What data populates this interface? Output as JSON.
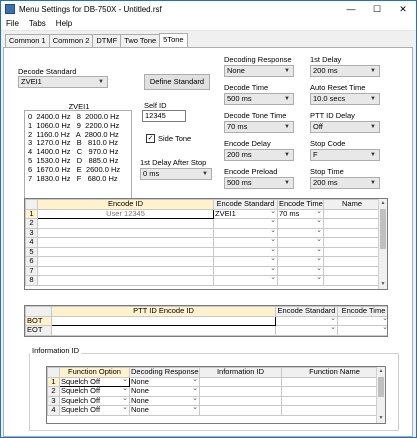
{
  "window": {
    "title": "Menu Settings for DB-750X - Untitled.rsf"
  },
  "titlebar_buttons": {
    "minimize": "—",
    "maximize": "☐",
    "close": "✕"
  },
  "menu": [
    "File",
    "Tabs",
    "Help"
  ],
  "tabs": [
    "Common 1",
    "Common 2",
    "DTMF",
    "Two Tone",
    "5Tone"
  ],
  "decode_standard": {
    "label": "Decode Standard",
    "value": "ZVEI1"
  },
  "define_standard_button": "Define Standard",
  "zvei_table": {
    "title": "ZVEI1",
    "rows": [
      "0  2400.0 Hz   8  2000.0 Hz",
      "1  1060.0 Hz   9  2200.0 Hz",
      "2  1160.0 Hz   A  2800.0 Hz",
      "3  1270.0 Hz   B   810.0 Hz",
      "4  1400.0 Hz   C   970.0 Hz",
      "5  1530.0 Hz   D   885.0 Hz",
      "6  1670.0 Hz   E  2600.0 Hz",
      "7  1830.0 Hz   F   680.0 Hz"
    ]
  },
  "self_id": {
    "label": "Self ID",
    "value": "12345"
  },
  "side_tone": {
    "label": "Side Tone",
    "checked": true,
    "mark": "✓"
  },
  "first_delay_after_stop": {
    "label": "1st Delay After Stop",
    "value": "0 ms"
  },
  "decoding_response": {
    "label": "Decoding Response",
    "value": "None"
  },
  "decode_time": {
    "label": "Decode Time",
    "value": "500 ms"
  },
  "decode_tone_time": {
    "label": "Decode Tone Time",
    "value": "70 ms"
  },
  "encode_delay": {
    "label": "Encode Delay",
    "value": "200 ms"
  },
  "encode_preload": {
    "label": "Encode Preload",
    "value": "500 ms"
  },
  "first_delay": {
    "label": "1st Delay",
    "value": "200 ms"
  },
  "auto_reset_time": {
    "label": "Auto Reset Time",
    "value": "10.0 secs"
  },
  "ptt_id_delay": {
    "label": "PTT ID Delay",
    "value": "Off"
  },
  "stop_code": {
    "label": "Stop Code",
    "value": "F"
  },
  "stop_time": {
    "label": "Stop Time",
    "value": "200 ms"
  },
  "encode_table": {
    "headers": [
      "Encode ID",
      "Encode Standard",
      "Encode Time",
      "Name"
    ],
    "rows": [
      {
        "num": "1",
        "id": "User 12345",
        "std": "ZVEI1",
        "time": "70 ms",
        "name": ""
      },
      {
        "num": "2",
        "id": "",
        "std": "",
        "time": "",
        "name": ""
      },
      {
        "num": "3",
        "id": "",
        "std": "",
        "time": "",
        "name": ""
      },
      {
        "num": "4",
        "id": "",
        "std": "",
        "time": "",
        "name": ""
      },
      {
        "num": "5",
        "id": "",
        "std": "",
        "time": "",
        "name": ""
      },
      {
        "num": "6",
        "id": "",
        "std": "",
        "time": "",
        "name": ""
      },
      {
        "num": "7",
        "id": "",
        "std": "",
        "time": "",
        "name": ""
      },
      {
        "num": "8",
        "id": "",
        "std": "",
        "time": "",
        "name": ""
      }
    ]
  },
  "ptt_table": {
    "headers": [
      "PTT ID Encode ID",
      "Encode Standard",
      "Encode Time"
    ],
    "rows": [
      {
        "num": "BOT",
        "id": "",
        "std": "",
        "time": ""
      },
      {
        "num": "EOT",
        "id": "",
        "std": "",
        "time": ""
      }
    ]
  },
  "information_id": {
    "title": "Information ID",
    "headers": [
      "Function Option",
      "Decoding Response",
      "Information ID",
      "Function Name"
    ],
    "rows": [
      {
        "num": "1",
        "opt": "Squelch Off",
        "resp": "None",
        "info": "",
        "name": ""
      },
      {
        "num": "2",
        "opt": "Squelch Off",
        "resp": "None",
        "info": "",
        "name": ""
      },
      {
        "num": "3",
        "opt": "Squelch Off",
        "resp": "None",
        "info": "",
        "name": ""
      },
      {
        "num": "4",
        "opt": "Squelch Off",
        "resp": "None",
        "info": "",
        "name": ""
      }
    ]
  }
}
